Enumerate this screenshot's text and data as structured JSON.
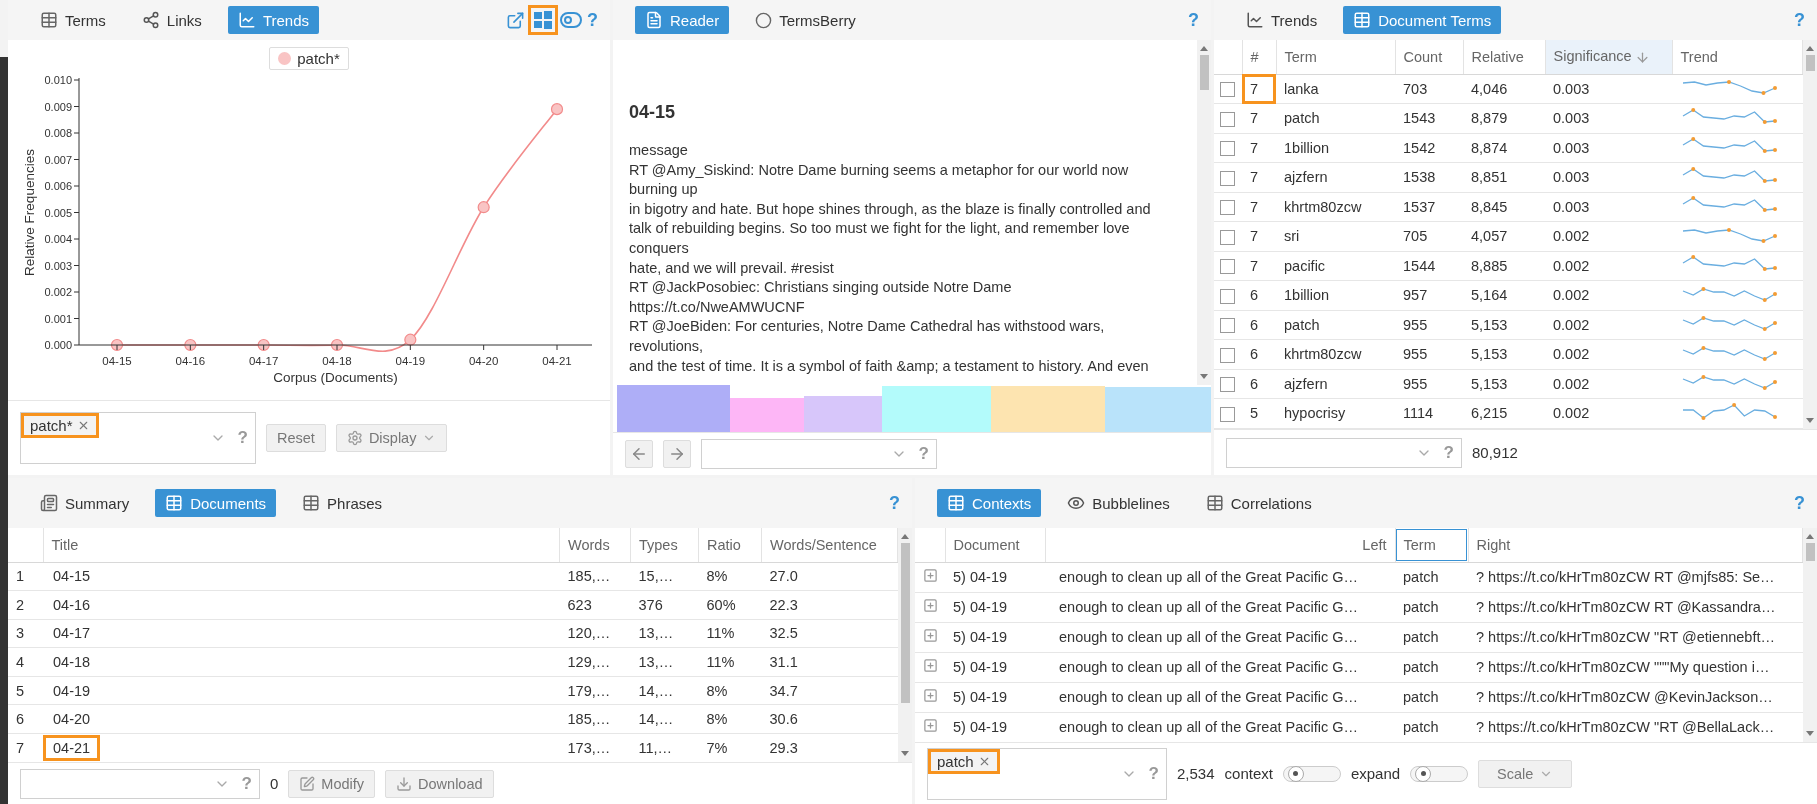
{
  "trends_panel": {
    "tabs": [
      {
        "label": "Terms",
        "selected": false
      },
      {
        "label": "Links",
        "selected": false
      },
      {
        "label": "Trends",
        "selected": true
      }
    ],
    "tools": [
      {
        "highlighted": false
      },
      {
        "highlighted": true
      }
    ],
    "help": "?",
    "chart_data": {
      "type": "line",
      "xlabel": "Corpus (Documents)",
      "ylabel": "Relative Frequencies",
      "categories": [
        "04-15",
        "04-16",
        "04-17",
        "04-18",
        "04-19",
        "04-20",
        "04-21"
      ],
      "series": [
        {
          "name": "patch*",
          "color": "#f28b8b",
          "marker": "o",
          "values": [
            0,
            0,
            0,
            0,
            0.0002,
            0.0052,
            0.0089
          ]
        }
      ],
      "ylim": [
        0,
        0.01
      ],
      "yticks": [
        {
          "value": 0,
          "label": "0.000"
        },
        {
          "value": 0.001,
          "label": "0.001"
        },
        {
          "value": 0.002,
          "label": "0.002"
        },
        {
          "value": 0.003,
          "label": "0.003"
        },
        {
          "value": 0.004,
          "label": "0.004"
        },
        {
          "value": 0.005,
          "label": "0.005"
        },
        {
          "value": 0.006,
          "label": "0.006"
        },
        {
          "value": 0.007,
          "label": "0.007"
        },
        {
          "value": 0.008,
          "label": "0.008"
        },
        {
          "value": 0.009,
          "label": "0.009"
        },
        {
          "value": 0.01,
          "label": "0.010"
        }
      ]
    },
    "query": {
      "chips": [
        {
          "label": "patch*",
          "highlighted": true
        }
      ],
      "help": "?"
    },
    "buttons": [
      {
        "label": "Reset"
      },
      {
        "label": "Display"
      }
    ]
  },
  "reader_panel": {
    "tabs": [
      {
        "label": "Reader",
        "selected": true
      },
      {
        "label": "TermsBerry",
        "selected": false
      }
    ],
    "help": "?",
    "title": "04-15",
    "lines": [
      "message",
      "RT @Amy_Siskind: Notre Dame burning seems a metaphor for our world now",
      "burning up",
      "in bigotry and hate. But hope shines through, as the blaze is finally controlled and",
      "talk of rebuilding begins. So too must we fight for the light, and remember love",
      "conquers",
      "hate, and we will prevail. #resist",
      "RT @JackPosobiec: Christians singing outside Notre Dame",
      "https://t.co/NweAMWUCNF",
      "RT @JoeBiden: For centuries, Notre Dame Cathedral has withstood wars,",
      "revolutions,",
      "and the test of time. It is a symbol of faith &amp; a testament to history. And even"
    ],
    "segments": [
      {
        "color": "#aeaef7"
      },
      {
        "color": "#fdb6f6"
      },
      {
        "color": "#d7c6fa"
      },
      {
        "color": "#b3fbfb"
      },
      {
        "color": "#fde4b0"
      },
      {
        "color": "#b9e3fa"
      }
    ],
    "footer_help": "?"
  },
  "document_terms_panel": {
    "tabs": [
      {
        "label": "Trends",
        "selected": false
      },
      {
        "label": "Document Terms",
        "selected": true
      }
    ],
    "help": "?",
    "columns": [
      {
        "label": "#",
        "sorted": false
      },
      {
        "label": "Term",
        "sorted": false
      },
      {
        "label": "Count",
        "sorted": false
      },
      {
        "label": "Relative",
        "sorted": false
      },
      {
        "label": "Significance",
        "sorted": true
      },
      {
        "label": "Trend",
        "sorted": false
      }
    ],
    "rows": [
      {
        "checked": false,
        "number": "7",
        "highlighted": true,
        "term": "lanka",
        "count": "703",
        "relative": "4,046",
        "significance": "0.003"
      },
      {
        "checked": false,
        "number": "7",
        "highlighted": false,
        "term": "patch",
        "count": "1543",
        "relative": "8,879",
        "significance": "0.003"
      },
      {
        "checked": false,
        "number": "7",
        "highlighted": false,
        "term": "1billion",
        "count": "1542",
        "relative": "8,874",
        "significance": "0.003"
      },
      {
        "checked": false,
        "number": "7",
        "highlighted": false,
        "term": "ajzfern",
        "count": "1538",
        "relative": "8,851",
        "significance": "0.003"
      },
      {
        "checked": false,
        "number": "7",
        "highlighted": false,
        "term": "khrtm80zcw",
        "count": "1537",
        "relative": "8,845",
        "significance": "0.003"
      },
      {
        "checked": false,
        "number": "7",
        "highlighted": false,
        "term": "sri",
        "count": "705",
        "relative": "4,057",
        "significance": "0.002"
      },
      {
        "checked": false,
        "number": "7",
        "highlighted": false,
        "term": "pacific",
        "count": "1544",
        "relative": "8,885",
        "significance": "0.002"
      },
      {
        "checked": false,
        "number": "6",
        "highlighted": false,
        "term": "1billion",
        "count": "957",
        "relative": "5,164",
        "significance": "0.002"
      },
      {
        "checked": false,
        "number": "6",
        "highlighted": false,
        "term": "patch",
        "count": "955",
        "relative": "5,153",
        "significance": "0.002"
      },
      {
        "checked": false,
        "number": "6",
        "highlighted": false,
        "term": "khrtm80zcw",
        "count": "955",
        "relative": "5,153",
        "significance": "0.002"
      },
      {
        "checked": false,
        "number": "6",
        "highlighted": false,
        "term": "ajzfern",
        "count": "955",
        "relative": "5,153",
        "significance": "0.002"
      },
      {
        "checked": false,
        "number": "5",
        "highlighted": false,
        "term": "hypocrisy",
        "count": "1114",
        "relative": "6,215",
        "significance": "0.002"
      }
    ],
    "footer_help": "?",
    "total": "80,912"
  },
  "documents_panel": {
    "tabs": [
      {
        "label": "Summary",
        "selected": false
      },
      {
        "label": "Documents",
        "selected": true
      },
      {
        "label": "Phrases",
        "selected": false
      }
    ],
    "help": "?",
    "columns": [
      "Title",
      "Words",
      "Types",
      "Ratio",
      "Words/Sentence"
    ],
    "rows": [
      {
        "index": "1",
        "title": "04-15",
        "highlighted": false,
        "words": "185,…",
        "types": "15,…",
        "ratio": "8%",
        "words_per_sentence": "27.0"
      },
      {
        "index": "2",
        "title": "04-16",
        "highlighted": false,
        "words": "623",
        "types": "376",
        "ratio": "60%",
        "words_per_sentence": "22.3"
      },
      {
        "index": "3",
        "title": "04-17",
        "highlighted": false,
        "words": "120,…",
        "types": "13,…",
        "ratio": "11%",
        "words_per_sentence": "32.5"
      },
      {
        "index": "4",
        "title": "04-18",
        "highlighted": false,
        "words": "129,…",
        "types": "13,…",
        "ratio": "11%",
        "words_per_sentence": "31.1"
      },
      {
        "index": "5",
        "title": "04-19",
        "highlighted": false,
        "words": "179,…",
        "types": "14,…",
        "ratio": "8%",
        "words_per_sentence": "34.7"
      },
      {
        "index": "6",
        "title": "04-20",
        "highlighted": false,
        "words": "185,…",
        "types": "14,…",
        "ratio": "8%",
        "words_per_sentence": "30.6"
      },
      {
        "index": "7",
        "title": "04-21",
        "highlighted": true,
        "words": "173,…",
        "types": "11,…",
        "ratio": "7%",
        "words_per_sentence": "29.3"
      }
    ],
    "footer_help": "?",
    "count": "0",
    "buttons": [
      {
        "label": "Modify"
      },
      {
        "label": "Download"
      }
    ]
  },
  "contexts_panel": {
    "tabs": [
      {
        "label": "Contexts",
        "selected": true
      },
      {
        "label": "Bubblelines",
        "selected": false
      },
      {
        "label": "Correlations",
        "selected": false
      }
    ],
    "help": "?",
    "columns": [
      {
        "label": "Document",
        "selected": false
      },
      {
        "label": "Left",
        "selected": false
      },
      {
        "label": "Term",
        "selected": true
      },
      {
        "label": "Right",
        "selected": false
      }
    ],
    "rows": [
      {
        "document": "5) 04-19",
        "left": "enough to clean up all of the Great Pacific G…",
        "term": "patch",
        "right": "? https://t.co/kHrTm80zCW RT @mjfs85: Se…"
      },
      {
        "document": "5) 04-19",
        "left": "enough to clean up all of the Great Pacific G…",
        "term": "patch",
        "right": "? https://t.co/kHrTm80zCW RT @Kassandra…"
      },
      {
        "document": "5) 04-19",
        "left": "enough to clean up all of the Great Pacific G…",
        "term": "patch",
        "right": "? https://t.co/kHrTm80zCW \"RT @etiennebft…"
      },
      {
        "document": "5) 04-19",
        "left": "enough to clean up all of the Great Pacific G…",
        "term": "patch",
        "right": "? https://t.co/kHrTm80zCW \"\"\"My question i…"
      },
      {
        "document": "5) 04-19",
        "left": "enough to clean up all of the Great Pacific G…",
        "term": "patch",
        "right": "? https://t.co/kHrTm80zCW @KevinJackson…"
      },
      {
        "document": "5) 04-19",
        "left": "enough to clean up all of the Great Pacific G…",
        "term": "patch",
        "right": "? https://t.co/kHrTm80zCW \"RT @BellaLack…"
      }
    ],
    "query": {
      "chips": [
        {
          "label": "patch",
          "highlighted": true
        }
      ],
      "help": "?"
    },
    "count": "2,534",
    "sliders": [
      {
        "label": "context"
      },
      {
        "label": "expand"
      }
    ],
    "button": "Scale"
  }
}
